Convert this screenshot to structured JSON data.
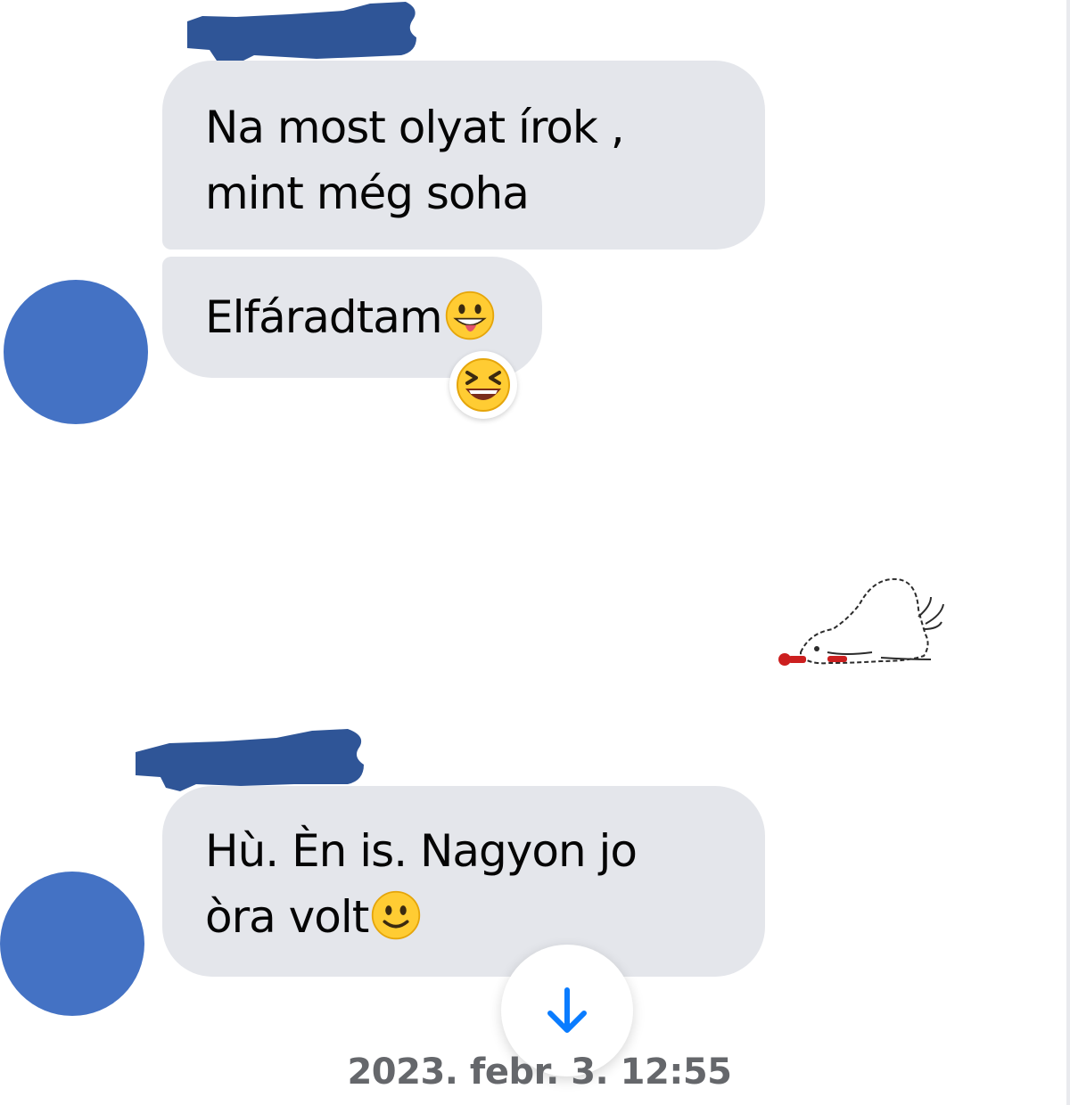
{
  "conversation": {
    "messages": [
      {
        "text": "Na most olyat írok  ,\nmint még soha",
        "emoji": ""
      },
      {
        "text": "Elfáradtam",
        "emoji": "grinning-face-with-tongue-icon",
        "reaction": "laughing-face-icon"
      },
      {
        "sticker": "tired-polar-bear-sticker"
      },
      {
        "text": "Hù. Èn is. Nagyon jo\nòra volt",
        "emoji": "slightly-smiling-face-icon"
      }
    ],
    "scroll_button_icon": "arrow-down-icon",
    "timestamp": "2023. febr. 3. 12:55"
  },
  "colors": {
    "bubble_bg": "#e4e6eb",
    "avatar_redaction": "#4472c4",
    "name_redaction": "#2f5597",
    "accent_blue": "#0a7cff",
    "timestamp": "#65676b"
  }
}
